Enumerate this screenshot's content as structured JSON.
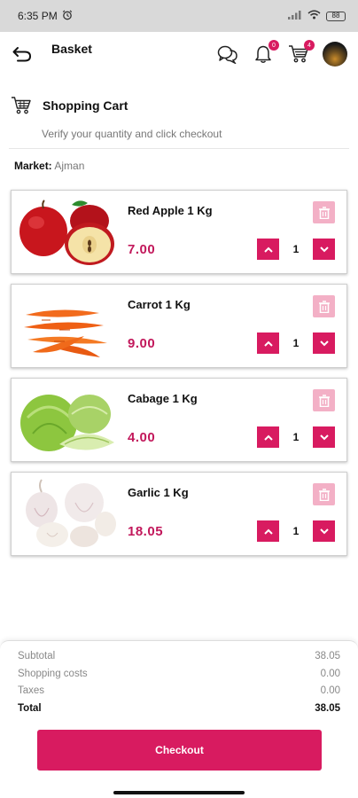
{
  "status": {
    "time": "6:35 PM",
    "alarm_icon": "alarm-icon",
    "signal_icon": "signal-icon",
    "wifi_icon": "wifi-icon",
    "battery": "88"
  },
  "appbar": {
    "title": "Basket",
    "chat_icon": "chat-icon",
    "notifications_badge": "0",
    "cart_badge": "4"
  },
  "section": {
    "title": "Shopping Cart",
    "subtitle": "Verify your quantity and click checkout"
  },
  "market": {
    "label": "Market:",
    "value": "Ajman"
  },
  "items": [
    {
      "name": "Red Apple 1 Kg",
      "price": "7.00",
      "qty": "1"
    },
    {
      "name": "Carrot 1 Kg",
      "price": "9.00",
      "qty": "1"
    },
    {
      "name": "Cabage 1 Kg",
      "price": "4.00",
      "qty": "1"
    },
    {
      "name": "Garlic 1 Kg",
      "price": "18.05",
      "qty": "1"
    }
  ],
  "summary": {
    "subtotal_label": "Subtotal",
    "subtotal_value": "38.05",
    "shipping_label": "Shopping costs",
    "shipping_value": "0.00",
    "taxes_label": "Taxes",
    "taxes_value": "0.00",
    "total_label": "Total",
    "total_value": "38.05"
  },
  "checkout_label": "Checkout",
  "colors": {
    "accent": "#d81b60",
    "accent_light": "#f3b0c6",
    "price": "#c2185b"
  }
}
